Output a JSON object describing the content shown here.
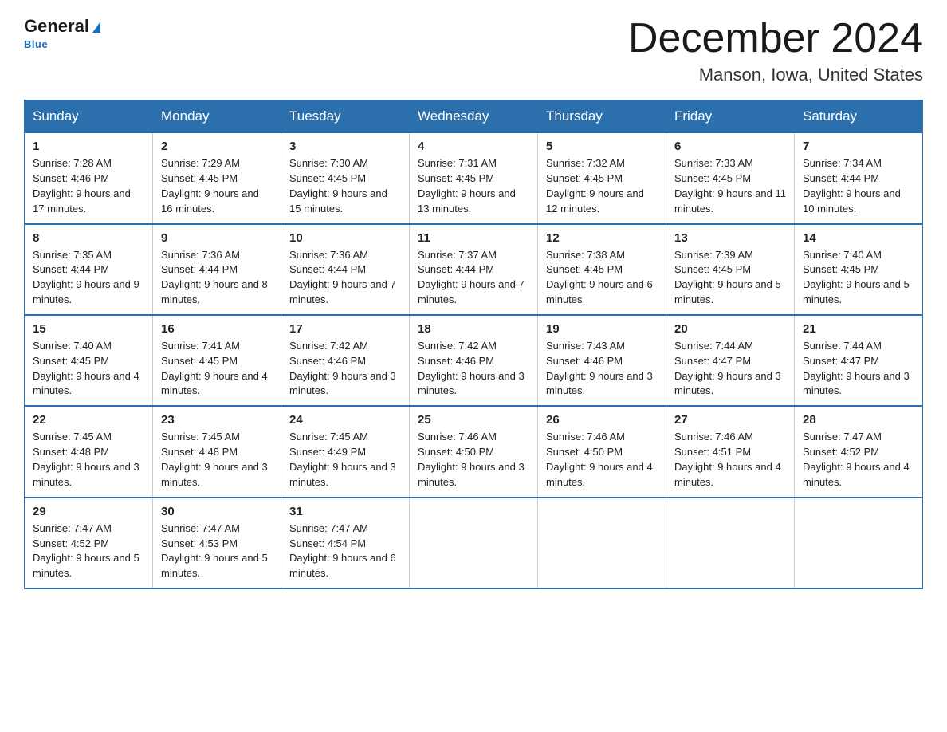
{
  "header": {
    "logo_general": "General",
    "logo_blue": "Blue",
    "month_title": "December 2024",
    "location": "Manson, Iowa, United States"
  },
  "days_of_week": [
    "Sunday",
    "Monday",
    "Tuesday",
    "Wednesday",
    "Thursday",
    "Friday",
    "Saturday"
  ],
  "weeks": [
    [
      {
        "day": "1",
        "sunrise": "Sunrise: 7:28 AM",
        "sunset": "Sunset: 4:46 PM",
        "daylight": "Daylight: 9 hours and 17 minutes."
      },
      {
        "day": "2",
        "sunrise": "Sunrise: 7:29 AM",
        "sunset": "Sunset: 4:45 PM",
        "daylight": "Daylight: 9 hours and 16 minutes."
      },
      {
        "day": "3",
        "sunrise": "Sunrise: 7:30 AM",
        "sunset": "Sunset: 4:45 PM",
        "daylight": "Daylight: 9 hours and 15 minutes."
      },
      {
        "day": "4",
        "sunrise": "Sunrise: 7:31 AM",
        "sunset": "Sunset: 4:45 PM",
        "daylight": "Daylight: 9 hours and 13 minutes."
      },
      {
        "day": "5",
        "sunrise": "Sunrise: 7:32 AM",
        "sunset": "Sunset: 4:45 PM",
        "daylight": "Daylight: 9 hours and 12 minutes."
      },
      {
        "day": "6",
        "sunrise": "Sunrise: 7:33 AM",
        "sunset": "Sunset: 4:45 PM",
        "daylight": "Daylight: 9 hours and 11 minutes."
      },
      {
        "day": "7",
        "sunrise": "Sunrise: 7:34 AM",
        "sunset": "Sunset: 4:44 PM",
        "daylight": "Daylight: 9 hours and 10 minutes."
      }
    ],
    [
      {
        "day": "8",
        "sunrise": "Sunrise: 7:35 AM",
        "sunset": "Sunset: 4:44 PM",
        "daylight": "Daylight: 9 hours and 9 minutes."
      },
      {
        "day": "9",
        "sunrise": "Sunrise: 7:36 AM",
        "sunset": "Sunset: 4:44 PM",
        "daylight": "Daylight: 9 hours and 8 minutes."
      },
      {
        "day": "10",
        "sunrise": "Sunrise: 7:36 AM",
        "sunset": "Sunset: 4:44 PM",
        "daylight": "Daylight: 9 hours and 7 minutes."
      },
      {
        "day": "11",
        "sunrise": "Sunrise: 7:37 AM",
        "sunset": "Sunset: 4:44 PM",
        "daylight": "Daylight: 9 hours and 7 minutes."
      },
      {
        "day": "12",
        "sunrise": "Sunrise: 7:38 AM",
        "sunset": "Sunset: 4:45 PM",
        "daylight": "Daylight: 9 hours and 6 minutes."
      },
      {
        "day": "13",
        "sunrise": "Sunrise: 7:39 AM",
        "sunset": "Sunset: 4:45 PM",
        "daylight": "Daylight: 9 hours and 5 minutes."
      },
      {
        "day": "14",
        "sunrise": "Sunrise: 7:40 AM",
        "sunset": "Sunset: 4:45 PM",
        "daylight": "Daylight: 9 hours and 5 minutes."
      }
    ],
    [
      {
        "day": "15",
        "sunrise": "Sunrise: 7:40 AM",
        "sunset": "Sunset: 4:45 PM",
        "daylight": "Daylight: 9 hours and 4 minutes."
      },
      {
        "day": "16",
        "sunrise": "Sunrise: 7:41 AM",
        "sunset": "Sunset: 4:45 PM",
        "daylight": "Daylight: 9 hours and 4 minutes."
      },
      {
        "day": "17",
        "sunrise": "Sunrise: 7:42 AM",
        "sunset": "Sunset: 4:46 PM",
        "daylight": "Daylight: 9 hours and 3 minutes."
      },
      {
        "day": "18",
        "sunrise": "Sunrise: 7:42 AM",
        "sunset": "Sunset: 4:46 PM",
        "daylight": "Daylight: 9 hours and 3 minutes."
      },
      {
        "day": "19",
        "sunrise": "Sunrise: 7:43 AM",
        "sunset": "Sunset: 4:46 PM",
        "daylight": "Daylight: 9 hours and 3 minutes."
      },
      {
        "day": "20",
        "sunrise": "Sunrise: 7:44 AM",
        "sunset": "Sunset: 4:47 PM",
        "daylight": "Daylight: 9 hours and 3 minutes."
      },
      {
        "day": "21",
        "sunrise": "Sunrise: 7:44 AM",
        "sunset": "Sunset: 4:47 PM",
        "daylight": "Daylight: 9 hours and 3 minutes."
      }
    ],
    [
      {
        "day": "22",
        "sunrise": "Sunrise: 7:45 AM",
        "sunset": "Sunset: 4:48 PM",
        "daylight": "Daylight: 9 hours and 3 minutes."
      },
      {
        "day": "23",
        "sunrise": "Sunrise: 7:45 AM",
        "sunset": "Sunset: 4:48 PM",
        "daylight": "Daylight: 9 hours and 3 minutes."
      },
      {
        "day": "24",
        "sunrise": "Sunrise: 7:45 AM",
        "sunset": "Sunset: 4:49 PM",
        "daylight": "Daylight: 9 hours and 3 minutes."
      },
      {
        "day": "25",
        "sunrise": "Sunrise: 7:46 AM",
        "sunset": "Sunset: 4:50 PM",
        "daylight": "Daylight: 9 hours and 3 minutes."
      },
      {
        "day": "26",
        "sunrise": "Sunrise: 7:46 AM",
        "sunset": "Sunset: 4:50 PM",
        "daylight": "Daylight: 9 hours and 4 minutes."
      },
      {
        "day": "27",
        "sunrise": "Sunrise: 7:46 AM",
        "sunset": "Sunset: 4:51 PM",
        "daylight": "Daylight: 9 hours and 4 minutes."
      },
      {
        "day": "28",
        "sunrise": "Sunrise: 7:47 AM",
        "sunset": "Sunset: 4:52 PM",
        "daylight": "Daylight: 9 hours and 4 minutes."
      }
    ],
    [
      {
        "day": "29",
        "sunrise": "Sunrise: 7:47 AM",
        "sunset": "Sunset: 4:52 PM",
        "daylight": "Daylight: 9 hours and 5 minutes."
      },
      {
        "day": "30",
        "sunrise": "Sunrise: 7:47 AM",
        "sunset": "Sunset: 4:53 PM",
        "daylight": "Daylight: 9 hours and 5 minutes."
      },
      {
        "day": "31",
        "sunrise": "Sunrise: 7:47 AM",
        "sunset": "Sunset: 4:54 PM",
        "daylight": "Daylight: 9 hours and 6 minutes."
      },
      null,
      null,
      null,
      null
    ]
  ]
}
